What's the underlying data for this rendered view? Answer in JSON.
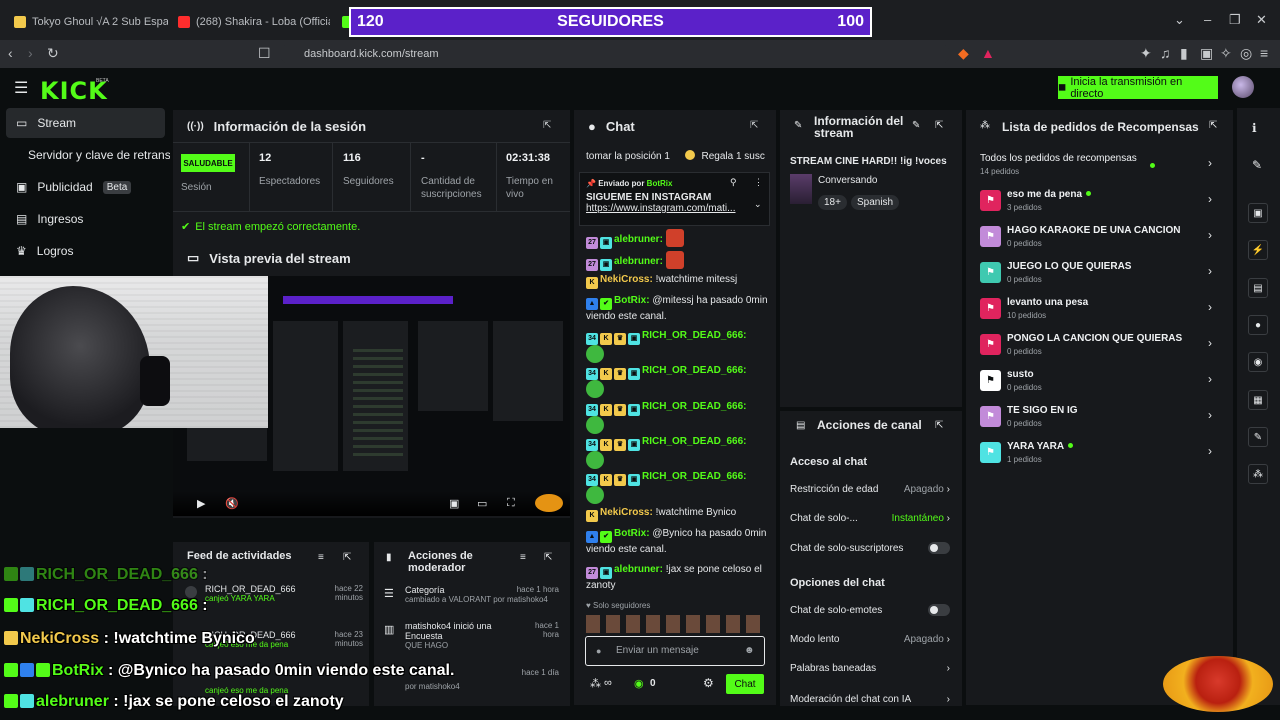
{
  "browser": {
    "tabs": [
      {
        "title": "Tokyo Ghoul √A 2 Sub Español Onlin",
        "color": "#f2c94c"
      },
      {
        "title": "(268) Shakira - Loba (Official HD Vid",
        "color": "#ff2d2d"
      },
      {
        "title": "",
        "color": "#53fc18"
      }
    ],
    "url": "dashboard.kick.com/stream"
  },
  "banner": {
    "left": "120",
    "center": "SEGUIDORES",
    "right": "100"
  },
  "header": {
    "logo": "KICK",
    "logo_sup": "BETA",
    "golive_label": "Inicia la transmisión en directo"
  },
  "sidebar": {
    "items": [
      {
        "label": "Stream"
      },
      {
        "label": "Servidor y clave de retransm"
      },
      {
        "label": "Publicidad",
        "badge": "Beta"
      },
      {
        "label": "Ingresos"
      },
      {
        "label": "Logros"
      }
    ]
  },
  "session": {
    "title": "Información de la sesión",
    "health": "SALUDABLE",
    "health_label": "Sesión",
    "stats": [
      {
        "value": "12",
        "label": "Espectadores"
      },
      {
        "value": "116",
        "label": "Seguidores"
      },
      {
        "value": "-",
        "label": "Cantidad de suscripciones"
      },
      {
        "value": "02:31:38",
        "label": "Tiempo en vivo"
      }
    ],
    "message": "El stream empezó correctamente."
  },
  "preview": {
    "title": "Vista previa del stream"
  },
  "chat": {
    "title": "Chat",
    "top_line_left": "tomar la posición 1",
    "top_line_right": "Regala 1 susc",
    "pinned_by_label": "Enviado por",
    "pinned_by": "BotRix",
    "pinned_text": "SIGUEME EN INSTAGRAM",
    "pinned_link": "https://www.instagram.com/mati...",
    "messages": [
      {
        "user": "alebruner:",
        "text": "",
        "color": "#53fc18"
      },
      {
        "user": "alebruner:",
        "text": "",
        "color": "#53fc18"
      },
      {
        "user": "NekiCross:",
        "text": "!watchtime mitessj",
        "color": "#f2c94c"
      },
      {
        "user": "BotRix:",
        "text": "@mitessj ha pasado 0min viendo este canal.",
        "color": "#53fc18"
      },
      {
        "user": "RICH_OR_DEAD_666:",
        "text": "",
        "color": "#53fc18"
      },
      {
        "user": "RICH_OR_DEAD_666:",
        "text": "",
        "color": "#53fc18"
      },
      {
        "user": "RICH_OR_DEAD_666:",
        "text": "",
        "color": "#53fc18"
      },
      {
        "user": "RICH_OR_DEAD_666:",
        "text": "",
        "color": "#53fc18"
      },
      {
        "user": "RICH_OR_DEAD_666:",
        "text": "",
        "color": "#53fc18"
      },
      {
        "user": "NekiCross:",
        "text": "!watchtime Bynico",
        "color": "#f2c94c"
      },
      {
        "user": "BotRix:",
        "text": "@Bynico ha pasado 0min viendo este canal.",
        "color": "#53fc18"
      },
      {
        "user": "alebruner:",
        "text": "!jax se pone celoso el zanoty",
        "color": "#53fc18"
      }
    ],
    "followers_only": "Solo seguidores",
    "input_placeholder": "Enviar un mensaje",
    "count": "0",
    "send_label": "Chat"
  },
  "stream_info": {
    "title": "Información del stream",
    "stream_title": "STREAM CINE HARD!! !ig !voces",
    "category": "Conversando",
    "tags": [
      "18+",
      "Spanish"
    ]
  },
  "channel_actions": {
    "title": "Acciones de canal",
    "chat_access": "Acceso al chat",
    "rows_access": [
      {
        "label": "Restricción de edad",
        "value": "Apagado",
        "type": "chevron"
      },
      {
        "label": "Chat de solo-...",
        "value": "Instantáneo",
        "type": "chevron-green"
      },
      {
        "label": "Chat de solo-suscriptores",
        "value": "",
        "type": "toggle"
      }
    ],
    "chat_options": "Opciones del chat",
    "rows_options": [
      {
        "label": "Chat de solo-emotes",
        "value": "",
        "type": "toggle"
      },
      {
        "label": "Modo lento",
        "value": "Apagado",
        "type": "chevron"
      },
      {
        "label": "Palabras baneadas",
        "value": "",
        "type": "chevron"
      },
      {
        "label": "Moderación del chat con IA",
        "value": "",
        "type": "chevron"
      }
    ]
  },
  "rewards": {
    "title": "Lista de pedidos de Recompensas",
    "all_label": "Todos los pedidos de recompensas",
    "all_count": "14 pedidos",
    "items": [
      {
        "name": "eso me da pena",
        "count": "3 pedidos",
        "color": "#e0245e",
        "dot": true
      },
      {
        "name": "HAGO KARAOKE DE UNA CANCION",
        "count": "0 pedidos",
        "color": "#c28bd9",
        "dot": false
      },
      {
        "name": "JUEGO LO QUE QUIERAS",
        "count": "0 pedidos",
        "color": "#3fc9b0",
        "dot": false
      },
      {
        "name": "levanto una pesa",
        "count": "10 pedidos",
        "color": "#e0245e",
        "dot": false
      },
      {
        "name": "PONGO LA CANCION QUE QUIERAS",
        "count": "0 pedidos",
        "color": "#e0245e",
        "dot": false
      },
      {
        "name": "susto",
        "count": "0 pedidos",
        "color": "#ffffff",
        "dot": false
      },
      {
        "name": "TE SIGO EN IG",
        "count": "0 pedidos",
        "color": "#c28bd9",
        "dot": false
      },
      {
        "name": "YARA YARA",
        "count": "1 pedidos",
        "color": "#4fe3e3",
        "dot": true
      }
    ]
  },
  "activity": {
    "title": "Feed de actividades",
    "items": [
      {
        "user": "RICH_OR_DEAD_666",
        "detail": "canjeó YARA YARA",
        "time": "hace 22 minutos"
      },
      {
        "user": "RICH_OR_DEAD_666",
        "detail": "canjeó eso me da pena",
        "time": "hace 23 minutos"
      },
      {
        "user": "",
        "detail": "canjeó eso me da pena",
        "time": ""
      }
    ]
  },
  "mod_actions": {
    "title": "Acciones de moderador",
    "items": [
      {
        "title": "Categoría",
        "detail": "cambiado a VALORANT por matishoko4",
        "time": "hace 1 hora"
      },
      {
        "title": "matishoko4 inició una Encuesta",
        "detail": "QUE HAGO",
        "time": "hace 1 hora"
      },
      {
        "title": "",
        "detail": "por matishoko4",
        "time": "hace 1 día"
      }
    ]
  },
  "overlay_chat": [
    {
      "user": "RICH_OR_DEAD_666",
      "text": ":",
      "color": "#53fc18"
    },
    {
      "user": "RICH_OR_DEAD_666",
      "text": ":",
      "color": "#53fc18"
    },
    {
      "user": "NekiCross",
      "text": ": !watchtime Bynico",
      "color": "#f2c94c"
    },
    {
      "user": "BotRix",
      "text": ": @Bynico ha pasado 0min viendo este canal.",
      "color": "#53fc18"
    },
    {
      "user": "alebruner",
      "text": ": !jax se pone celoso el zanoty",
      "color": "#53fc18"
    }
  ]
}
